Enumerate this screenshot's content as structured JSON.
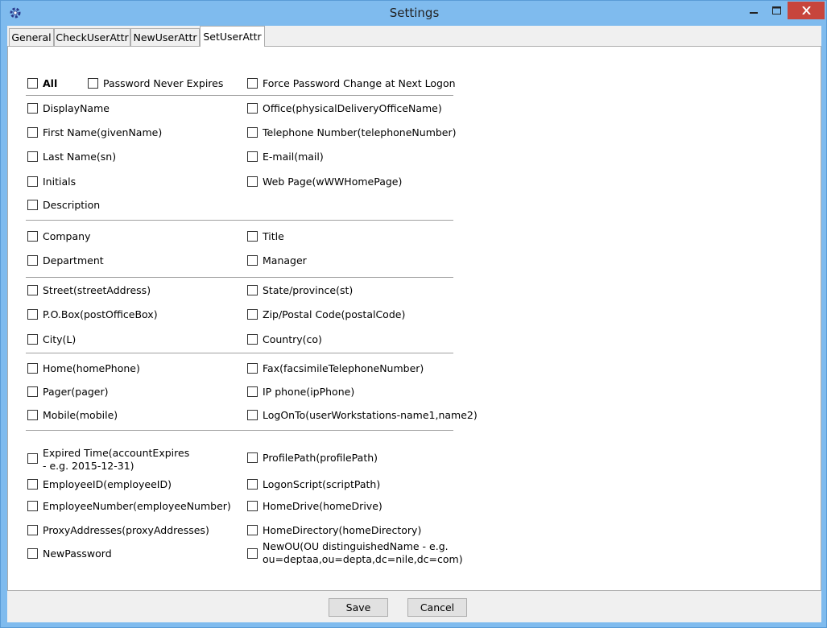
{
  "window": {
    "title": "Settings",
    "close_color": "#c7453c",
    "accent": "#7fbbee"
  },
  "tabs": [
    {
      "label": "General"
    },
    {
      "label": "CheckUserAttr"
    },
    {
      "label": "NewUserAttr"
    },
    {
      "label": "SetUserAttr",
      "active": true
    }
  ],
  "options": {
    "all": "All",
    "password_never_expires": "Password Never Expires",
    "force_password_change": "Force Password Change at Next Logon",
    "display_name": "DisplayName",
    "office": "Office(physicalDeliveryOfficeName)",
    "first_name": "First Name(givenName)",
    "telephone": "Telephone Number(telephoneNumber)",
    "last_name": "Last Name(sn)",
    "email": "E-mail(mail)",
    "initials": "Initials",
    "web_page": "Web Page(wWWHomePage)",
    "description": "Description",
    "company": "Company",
    "title": "Title",
    "department": "Department",
    "manager": "Manager",
    "street": "Street(streetAddress)",
    "state": "State/province(st)",
    "po_box": "P.O.Box(postOfficeBox)",
    "zip": "Zip/Postal Code(postalCode)",
    "city": "City(L)",
    "country": "Country(co)",
    "home_phone": "Home(homePhone)",
    "fax": "Fax(facsimileTelephoneNumber)",
    "pager": "Pager(pager)",
    "ip_phone": "IP phone(ipPhone)",
    "mobile": "Mobile(mobile)",
    "logon_to": "LogOnTo(userWorkstations-name1,name2)",
    "expired_time": "Expired Time(accountExpires - e.g. 2015-12-31)",
    "profile_path": "ProfilePath(profilePath)",
    "employee_id": "EmployeeID(employeeID)",
    "logon_script": "LogonScript(scriptPath)",
    "employee_number": "EmployeeNumber(employeeNumber)",
    "home_drive": "HomeDrive(homeDrive)",
    "proxy_addresses": "ProxyAddresses(proxyAddresses)",
    "home_directory": "HomeDirectory(homeDirectory)",
    "new_password": "NewPassword",
    "new_ou": "NewOU(OU distinguishedName - e.g. ou=deptaa,ou=depta,dc=nile,dc=com)"
  },
  "buttons": {
    "save": "Save",
    "cancel": "Cancel"
  }
}
